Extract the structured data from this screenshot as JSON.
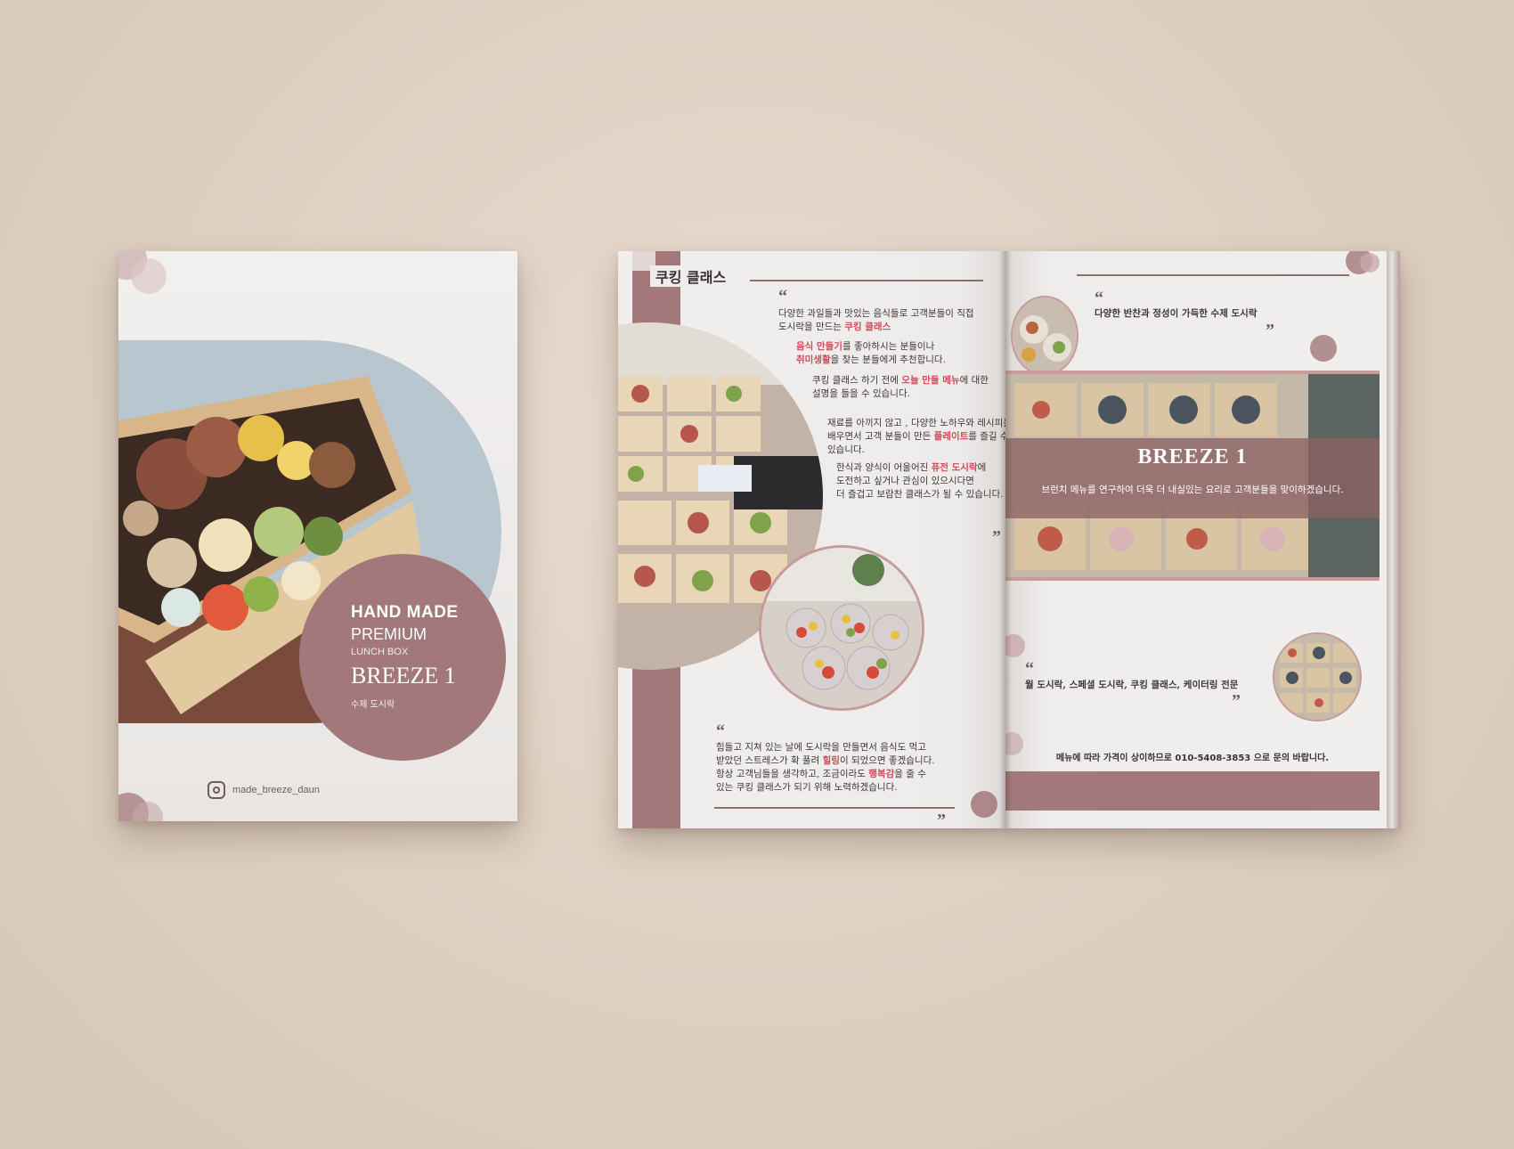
{
  "cover": {
    "line1": "HAND MADE",
    "line2": "PREMIUM",
    "line3": "LUNCH BOX",
    "brand": "BREEZE 1",
    "subtitle": "수제 도시락",
    "instagram_handle": "made_breeze_daun"
  },
  "left_page": {
    "title": "쿠킹 클래스",
    "para1": [
      "다양한 과일들과 맛있는 음식들로 고객분들이 직접",
      "도시락을 만드는 "
    ],
    "para1_highlight": "쿠킹 클래스",
    "para2_highlight_a": "음식 만들기",
    "para2_text_a": "를 좋아하시는 분들이나",
    "para2_highlight_b": "취미생활",
    "para2_text_b": "을 찾는 분들에게 추천합니다.",
    "para3_a": "쿠킹 클래스 하기 전에 ",
    "para3_highlight": "오늘 만들 메뉴",
    "para3_b": "에 대한",
    "para3_c": "설명을 들을 수 있습니다.",
    "para4_a": "재료를 아끼지 않고 , 다양한 노하우와 레시피를",
    "para4_b": "배우면서 고객 분들이 만든 ",
    "para4_highlight": "플레이트",
    "para4_c": "를 즐길 수",
    "para4_d": "있습니다.",
    "para5_a": "한식과 양식이 어울어진 ",
    "para5_highlight": "퓨전 도시락",
    "para5_b": "에",
    "para5_c": "도전하고 싶거나 관심이 있으시다면",
    "para5_d": "더 즐겁고 보람찬 클래스가 될 수 있습니다.",
    "bottom_a": "힘들고 지쳐 있는 날에 도시락을 만들면서 음식도 먹고",
    "bottom_b": "받았던 스트레스가 확 풀려 ",
    "bottom_highlight1": "힐링",
    "bottom_c": "이 되었으면 좋겠습니다.",
    "bottom_d": "항상 고객님들을 생각하고, 조금이라도 ",
    "bottom_highlight2": "행복감",
    "bottom_e": "을 줄 수",
    "bottom_f": "있는 쿠킹 클래스가 되기 위해 노력하겠습니다."
  },
  "right_page": {
    "top_text": "다양한 반찬과 정성이 가득한 수제 도시락",
    "banner_title": "BREEZE 1",
    "banner_text": "브런치 메뉴를 연구하여 더욱 더 내실있는 요리로 고객분들을 맞이하겠습니다.",
    "services": "월 도시락, 스페셜 도시락, 쿠킹 클래스, 케이터링 전문",
    "contact": "메뉴에 따라 가격이 상이하므로 010-5408-3853 으로 문의 바랍니다."
  },
  "glyphs": {
    "open_quote": "“",
    "close_quote": "”"
  },
  "colors": {
    "mauve": "#a2787a",
    "highlight": "#d04a58",
    "background": "#ddcfc0"
  }
}
